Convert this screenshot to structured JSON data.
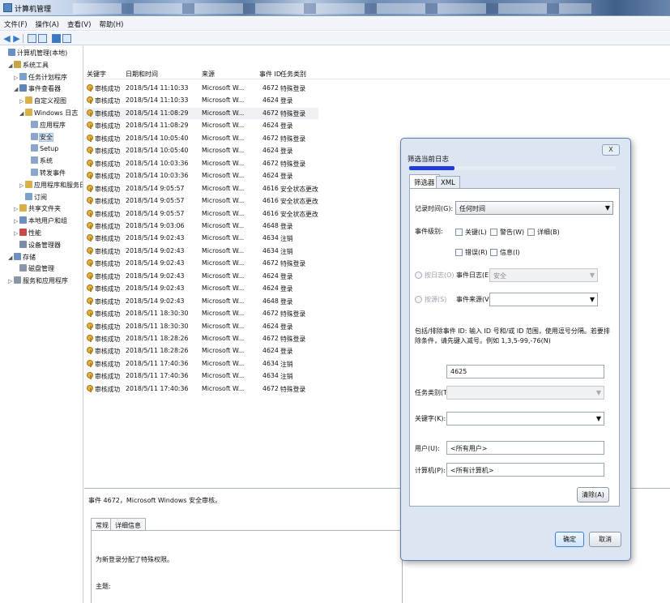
{
  "window": {
    "title": "计算机管理"
  },
  "menu": [
    "文件(F)",
    "操作(A)",
    "查看(V)",
    "帮助(H)"
  ],
  "tree": [
    {
      "label": "计算机管理(本地)",
      "indent": 0,
      "exp": "",
      "icon": "#6a8fc4"
    },
    {
      "label": "系统工具",
      "indent": 1,
      "exp": "◢",
      "icon": "#c9a446"
    },
    {
      "label": "任务计划程序",
      "indent": 2,
      "exp": "▷",
      "icon": "#7aa0cc"
    },
    {
      "label": "事件查看器",
      "indent": 2,
      "exp": "◢",
      "icon": "#5f86b8"
    },
    {
      "label": "自定义视图",
      "indent": 3,
      "exp": "▷",
      "icon": "#d8b04a"
    },
    {
      "label": "Windows 日志",
      "indent": 3,
      "exp": "◢",
      "icon": "#d8b04a"
    },
    {
      "label": "应用程序",
      "indent": 4,
      "exp": "",
      "icon": "#8aa6c8"
    },
    {
      "label": "安全",
      "indent": 4,
      "exp": "",
      "icon": "#8aa6c8",
      "selected": true
    },
    {
      "label": "Setup",
      "indent": 4,
      "exp": "",
      "icon": "#8aa6c8"
    },
    {
      "label": "系统",
      "indent": 4,
      "exp": "",
      "icon": "#8aa6c8"
    },
    {
      "label": "转发事件",
      "indent": 4,
      "exp": "",
      "icon": "#8aa6c8"
    },
    {
      "label": "应用程序和服务日志",
      "indent": 3,
      "exp": "▷",
      "icon": "#d8b04a"
    },
    {
      "label": "订阅",
      "indent": 3,
      "exp": "",
      "icon": "#7aa0cc"
    },
    {
      "label": "共享文件夹",
      "indent": 2,
      "exp": "▷",
      "icon": "#d8b04a"
    },
    {
      "label": "本地用户和组",
      "indent": 2,
      "exp": "▷",
      "icon": "#6f8fbf"
    },
    {
      "label": "性能",
      "indent": 2,
      "exp": "▷",
      "icon": "#c84a4a"
    },
    {
      "label": "设备管理器",
      "indent": 2,
      "exp": "",
      "icon": "#7a8ca8"
    },
    {
      "label": "存储",
      "indent": 1,
      "exp": "◢",
      "icon": "#6f8fbf"
    },
    {
      "label": "磁盘管理",
      "indent": 2,
      "exp": "",
      "icon": "#8a96a8"
    },
    {
      "label": "服务和应用程序",
      "indent": 1,
      "exp": "▷",
      "icon": "#8a96a8"
    }
  ],
  "list": {
    "columns": [
      "关键字",
      "日期和时间",
      "来源",
      "事件 ID",
      "任务类别"
    ],
    "rows": [
      [
        "审核成功",
        "2018/5/14 11:10:33",
        "Microsoft W...",
        "4672",
        "特殊登录"
      ],
      [
        "审核成功",
        "2018/5/14 11:10:33",
        "Microsoft W...",
        "4624",
        "登录"
      ],
      [
        "审核成功",
        "2018/5/14 11:08:29",
        "Microsoft W...",
        "4672",
        "特殊登录"
      ],
      [
        "审核成功",
        "2018/5/14 11:08:29",
        "Microsoft W...",
        "4624",
        "登录"
      ],
      [
        "审核成功",
        "2018/5/14 10:05:40",
        "Microsoft W...",
        "4672",
        "特殊登录"
      ],
      [
        "审核成功",
        "2018/5/14 10:05:40",
        "Microsoft W...",
        "4624",
        "登录"
      ],
      [
        "审核成功",
        "2018/5/14 10:03:36",
        "Microsoft W...",
        "4672",
        "特殊登录"
      ],
      [
        "审核成功",
        "2018/5/14 10:03:36",
        "Microsoft W...",
        "4624",
        "登录"
      ],
      [
        "审核成功",
        "2018/5/14 9:05:57",
        "Microsoft W...",
        "4616",
        "安全状态更改"
      ],
      [
        "审核成功",
        "2018/5/14 9:05:57",
        "Microsoft W...",
        "4616",
        "安全状态更改"
      ],
      [
        "审核成功",
        "2018/5/14 9:05:57",
        "Microsoft W...",
        "4616",
        "安全状态更改"
      ],
      [
        "审核成功",
        "2018/5/14 9:03:06",
        "Microsoft W...",
        "4648",
        "登录"
      ],
      [
        "审核成功",
        "2018/5/14 9:02:43",
        "Microsoft W...",
        "4634",
        "注销"
      ],
      [
        "审核成功",
        "2018/5/14 9:02:43",
        "Microsoft W...",
        "4634",
        "注销"
      ],
      [
        "审核成功",
        "2018/5/14 9:02:43",
        "Microsoft W...",
        "4672",
        "特殊登录"
      ],
      [
        "审核成功",
        "2018/5/14 9:02:43",
        "Microsoft W...",
        "4624",
        "登录"
      ],
      [
        "审核成功",
        "2018/5/14 9:02:43",
        "Microsoft W...",
        "4624",
        "登录"
      ],
      [
        "审核成功",
        "2018/5/14 9:02:43",
        "Microsoft W...",
        "4648",
        "登录"
      ],
      [
        "审核成功",
        "2018/5/11 18:30:30",
        "Microsoft W...",
        "4672",
        "特殊登录"
      ],
      [
        "审核成功",
        "2018/5/11 18:30:30",
        "Microsoft W...",
        "4624",
        "登录"
      ],
      [
        "审核成功",
        "2018/5/11 18:28:26",
        "Microsoft W...",
        "4672",
        "特殊登录"
      ],
      [
        "审核成功",
        "2018/5/11 18:28:26",
        "Microsoft W...",
        "4624",
        "登录"
      ],
      [
        "审核成功",
        "2018/5/11 17:40:36",
        "Microsoft W...",
        "4634",
        "注销"
      ],
      [
        "审核成功",
        "2018/5/11 17:40:36",
        "Microsoft W...",
        "4634",
        "注销"
      ],
      [
        "审核成功",
        "2018/5/11 17:40:36",
        "Microsoft W...",
        "4672",
        "特殊登录"
      ]
    ],
    "highlighted_row": 2
  },
  "detail": {
    "title": "事件 4672，Microsoft Windows 安全审核。",
    "tabs": [
      "常规",
      "详细信息"
    ],
    "message": "为新登录分配了特殊权限。",
    "subject_label": "主题:"
  },
  "dialog": {
    "title": "筛选当前日志",
    "close": "X",
    "progress": 0.22,
    "tabs": [
      "筛选器",
      "XML"
    ],
    "logged_label": "记录时间(G):",
    "logged_value": "任何时间",
    "level_label": "事件级别:",
    "levels": [
      "关键(L)",
      "警告(W)",
      "详细(B)",
      "错误(R)",
      "信息(I)"
    ],
    "by_log_label": "按日志(O)",
    "event_log_label": "事件日志(E):",
    "event_log_value": "安全",
    "by_source_label": "按源(S)",
    "event_source_label": "事件来源(V):",
    "include_text": "包括/排除事件 ID: 输入 ID 号和/或 ID 范围，使用逗号分隔。若要排除条件，请先键入减号。例如 1,3,5-99,-76(N)",
    "event_id_value": "4625",
    "task_label": "任务类别(T):",
    "keywords_label": "关键字(K):",
    "user_label": "用户(U):",
    "user_value": "<所有用户>",
    "computer_label": "计算机(P):",
    "computer_value": "<所有计算机>",
    "clear": "清除(A)",
    "ok": "确定",
    "cancel": "取消"
  }
}
